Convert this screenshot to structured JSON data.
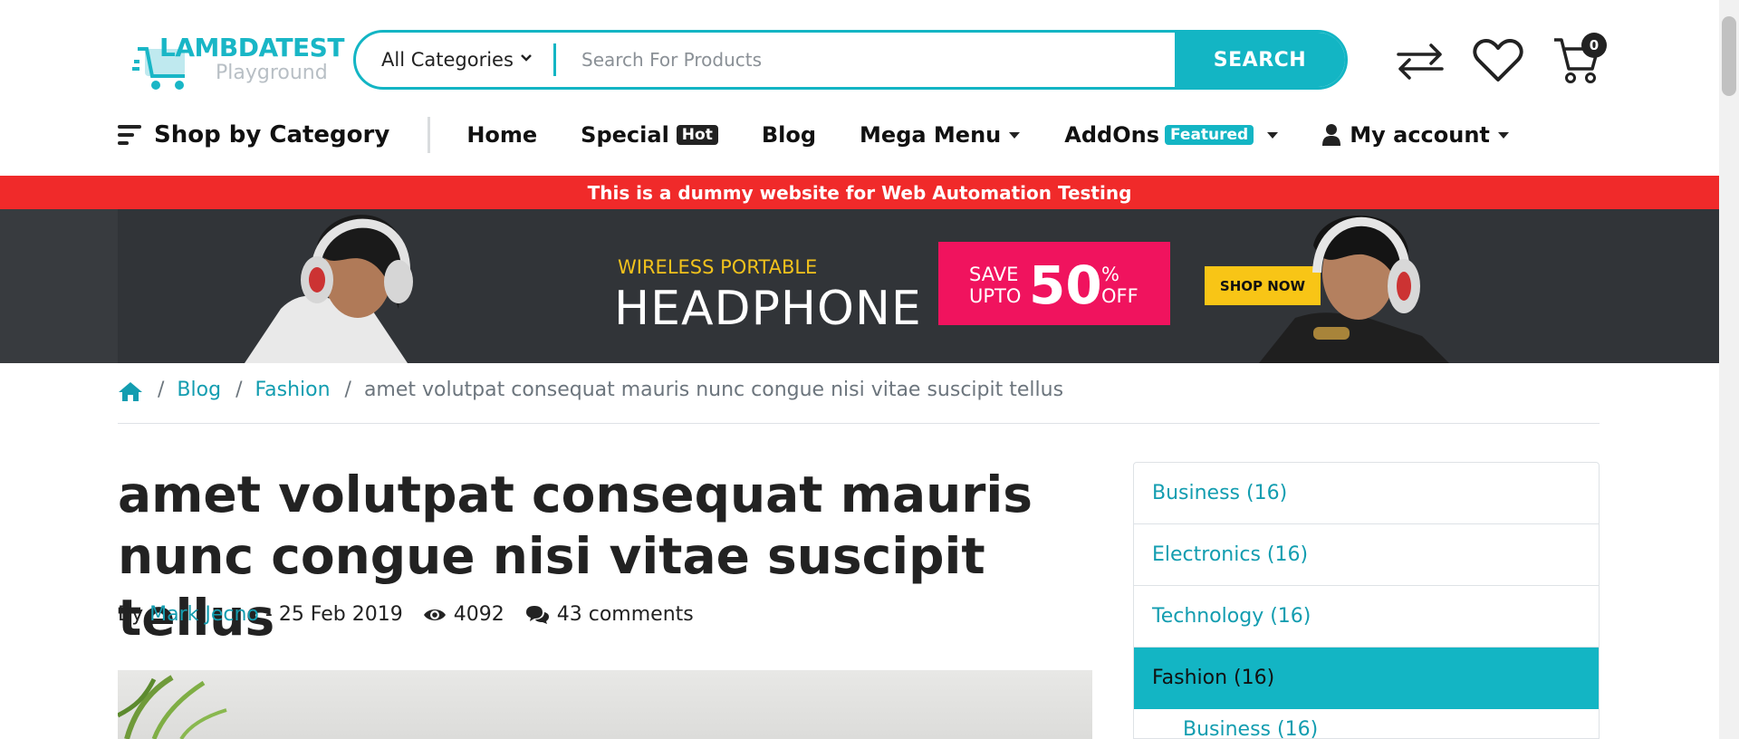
{
  "header": {
    "logo_brand": "LAMBDATEST",
    "logo_sub": "Playground",
    "category_select": "All Categories",
    "search_placeholder": "Search For Products",
    "search_button": "SEARCH",
    "cart_count": "0",
    "icons": [
      "compare-icon",
      "heart-icon",
      "cart-icon"
    ]
  },
  "nav": {
    "shop_by_category": "Shop by Category",
    "items": [
      {
        "label": "Home"
      },
      {
        "label": "Special",
        "badge": "Hot"
      },
      {
        "label": "Blog"
      },
      {
        "label": "Mega Menu"
      },
      {
        "label": "AddOns",
        "badge": "Featured"
      },
      {
        "label": "My account"
      }
    ]
  },
  "notice": "This is a dummy website for Web Automation Testing",
  "banner": {
    "line1": "WIRELESS PORTABLE",
    "line2": "HEADPHONE",
    "save": "SAVE",
    "upto": "UPTO",
    "percent_value": "50",
    "percent_sign": "%",
    "off": "OFF",
    "cta": "SHOP NOW"
  },
  "breadcrumb": {
    "items": [
      "Blog",
      "Fashion"
    ],
    "current": "amet volutpat consequat mauris nunc congue nisi vitae suscipit tellus"
  },
  "article": {
    "title": "amet volutpat consequat mauris nunc congue nisi vitae suscipit tellus",
    "by": "By",
    "author": "Mark Jecno",
    "date": "- 25 Feb 2019",
    "views": "4092",
    "comments": "43 comments"
  },
  "sidebar": {
    "categories": [
      {
        "label": "Business (16)",
        "active": false
      },
      {
        "label": "Electronics (16)",
        "active": false
      },
      {
        "label": "Technology (16)",
        "active": false
      },
      {
        "label": "Fashion (16)",
        "active": true
      }
    ],
    "subitem": "Business (16)"
  },
  "colors": {
    "accent": "#13b5c4",
    "notice_red": "#f02a2a",
    "sale_pink": "#f0135e",
    "cta_yellow": "#f8c516"
  }
}
